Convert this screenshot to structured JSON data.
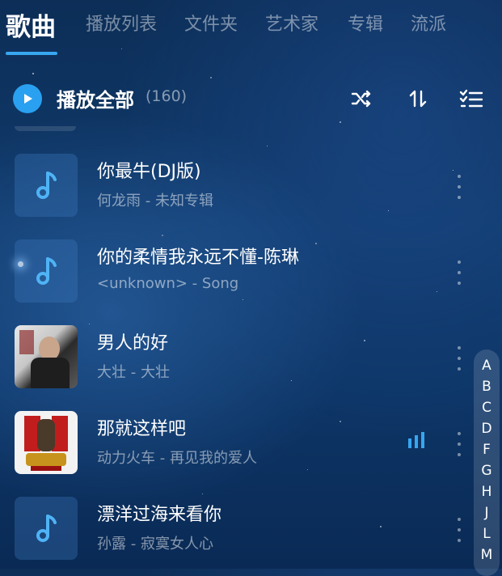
{
  "tabs": [
    {
      "label": "歌曲",
      "active": true
    },
    {
      "label": "播放列表"
    },
    {
      "label": "文件夹"
    },
    {
      "label": "艺术家"
    },
    {
      "label": "专辑"
    },
    {
      "label": "流派"
    }
  ],
  "header": {
    "play_all_label": "播放全部",
    "count": "(160)",
    "icons": [
      "shuffle-icon",
      "sort-icon",
      "multi-select-icon"
    ]
  },
  "songs": [
    {
      "title": "你最牛(DJ版)",
      "subtitle": "何龙雨 - 未知专辑",
      "art": "music-note-icon"
    },
    {
      "title": "你的柔情我永远不懂-陈琳",
      "subtitle": "<unknown> - Song",
      "art": "music-note-icon"
    },
    {
      "title": "男人的好",
      "subtitle": "大壮 - 大壮",
      "art": "album-cover"
    },
    {
      "title": "那就这样吧",
      "subtitle": "动力火车 - 再见我的爱人",
      "art": "album-cover",
      "playing": true
    },
    {
      "title": "漂洋过海来看你",
      "subtitle": "孙露 - 寂寞女人心",
      "art": "music-note-icon"
    }
  ],
  "alphabet": [
    "A",
    "B",
    "C",
    "D",
    "F",
    "G",
    "H",
    "J",
    "L",
    "M"
  ],
  "colors": {
    "accent": "#2aa0f0",
    "background": "#0f3565"
  }
}
